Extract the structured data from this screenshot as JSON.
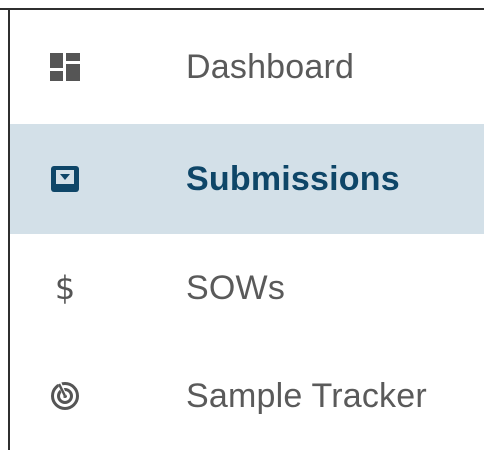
{
  "nav": {
    "items": [
      {
        "label": "Dashboard",
        "icon": "dashboard-icon",
        "active": false
      },
      {
        "label": "Submissions",
        "icon": "submissions-icon",
        "active": true
      },
      {
        "label": "SOWs",
        "icon": "dollar-icon",
        "active": false
      },
      {
        "label": "Sample Tracker",
        "icon": "radar-icon",
        "active": false
      }
    ],
    "dollar_glyph": "$"
  },
  "colors": {
    "active_background": "#d3e0e8",
    "active_text": "#0e4668",
    "inactive_text": "#5a5a5a",
    "icon_gray": "#555555",
    "border": "#2f2f2f"
  }
}
